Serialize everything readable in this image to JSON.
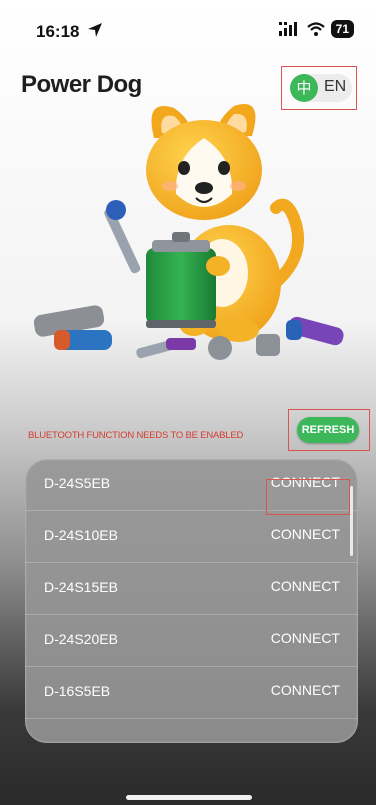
{
  "status": {
    "time": "16:18",
    "battery": "71"
  },
  "app": {
    "title": "Power Dog"
  },
  "language": {
    "zh": "中",
    "en": "EN"
  },
  "bluetooth": {
    "warning": "BLUETOOTH FUNCTION NEEDS TO BE ENABLED",
    "refresh_label": "REFRESH"
  },
  "devices": [
    {
      "name": "D-24S5EB",
      "action": "CONNECT"
    },
    {
      "name": "D-24S10EB",
      "action": "CONNECT"
    },
    {
      "name": "D-24S15EB",
      "action": "CONNECT"
    },
    {
      "name": "D-24S20EB",
      "action": "CONNECT"
    },
    {
      "name": "D-16S5EB",
      "action": "CONNECT"
    }
  ],
  "colors": {
    "accent_green": "#3cb85b",
    "warning_red": "#d63c30",
    "highlight_red": "#d9534f"
  }
}
